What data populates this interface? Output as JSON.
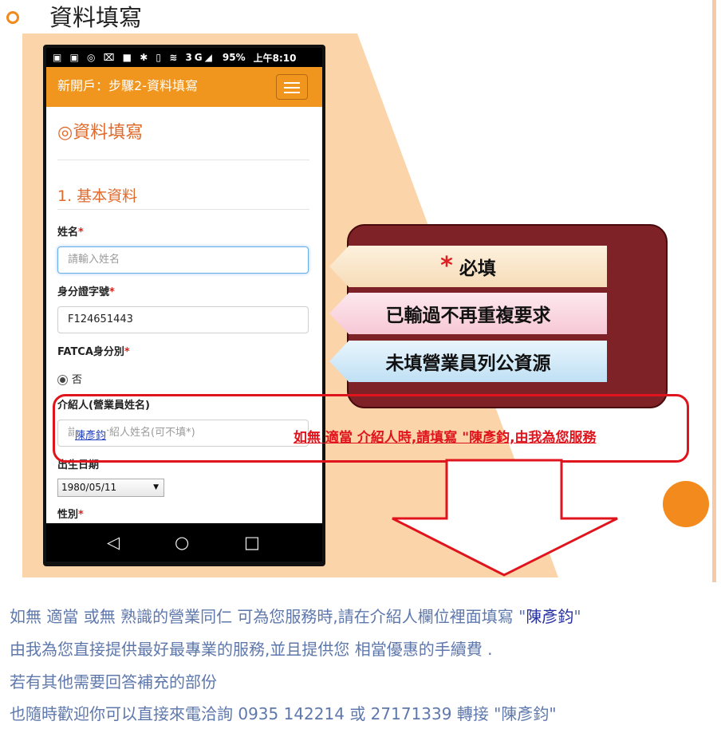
{
  "slide": {
    "title": "資料填寫",
    "accent_color": "#f0891e"
  },
  "phone": {
    "status_bar": {
      "icons": "▣ ▣ ◎ ⌧ ■ ✱ ▯ ≋ 3G◢",
      "battery": "95%",
      "time": "上午8:10"
    },
    "app_bar": {
      "title": "新開戶：步驟2-資料填寫",
      "menu_icon": "hamburger-icon"
    },
    "form": {
      "heading": "◎資料填寫",
      "section": "1. 基本資料",
      "name_label": "姓名",
      "name_placeholder": "請輸入姓名",
      "id_label": "身分證字號",
      "id_value": "F124651443",
      "fatca_label": "FATCA身分別",
      "fatca_option": "否",
      "referrer_label": "介紹人(營業員姓名)",
      "referrer_placeholder": "請輸入介紹人姓名(可不填*)",
      "referrer_inline_name": "陳彥鈞",
      "birth_label": "出生日期",
      "birth_value": "1980/05/11",
      "gender_label": "性別",
      "required_mark": "*"
    },
    "nav": {
      "back_icon": "◁",
      "home_icon": "○",
      "recent_icon": "□"
    }
  },
  "callout": {
    "tag1_star": "*",
    "tag1": "必填",
    "tag2": "已輸過不再重複要求",
    "tag3": "未填營業員列公資源",
    "red_note": "如無 適當 介紹人時,請填寫 \"陳彥鈞,由我為您服務"
  },
  "bottom_text": {
    "line1_pre": "如無 適當 或無 熟識的營業同仁 可為您服務時,請在介紹人欄位裡面填寫 \"",
    "line1_name": "陳彥鈞",
    "line1_post": "\"",
    "line2": "由我為您直接提供最好最專業的服務,並且提供您 相當優惠的手續費 .",
    "line3": "若有其他需要回答補充的部份",
    "line4": "也隨時歡迎你可以直接來電洽詢 0935 142214 或 27171339 轉接 \"陳彥鈞\""
  }
}
